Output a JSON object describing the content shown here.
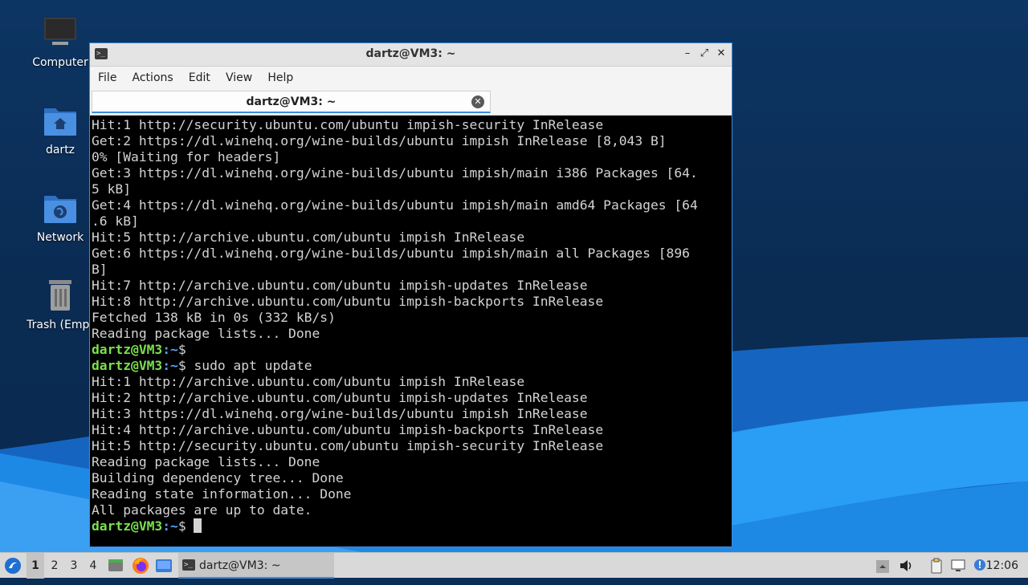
{
  "desktop": {
    "icons": [
      {
        "label": "Computer",
        "icon": "computer-icon"
      },
      {
        "label": "dartz",
        "icon": "home-folder-icon"
      },
      {
        "label": "Network",
        "icon": "network-folder-icon"
      },
      {
        "label": "Trash (Empt",
        "icon": "trash-icon"
      }
    ]
  },
  "window": {
    "title": "dartz@VM3: ~",
    "menu": [
      "File",
      "Actions",
      "Edit",
      "View",
      "Help"
    ],
    "tab_label": "dartz@VM3: ~",
    "accent": "#3a8be0"
  },
  "terminal": {
    "prompt_user": "dartz@VM3",
    "prompt_path": ":~",
    "prompt_symbol": "$",
    "lines": [
      {
        "text": "Hit:1 http://security.ubuntu.com/ubuntu impish-security InRelease"
      },
      {
        "text": "Get:2 https://dl.winehq.org/wine-builds/ubuntu impish InRelease [8,043 B]"
      },
      {
        "text": "0% [Waiting for headers]"
      },
      {
        "text": "Get:3 https://dl.winehq.org/wine-builds/ubuntu impish/main i386 Packages [64."
      },
      {
        "text": "5 kB]"
      },
      {
        "text": "Get:4 https://dl.winehq.org/wine-builds/ubuntu impish/main amd64 Packages [64"
      },
      {
        "text": ".6 kB]"
      },
      {
        "text": "Hit:5 http://archive.ubuntu.com/ubuntu impish InRelease"
      },
      {
        "text": "Get:6 https://dl.winehq.org/wine-builds/ubuntu impish/main all Packages [896"
      },
      {
        "text": "B]"
      },
      {
        "text": "Hit:7 http://archive.ubuntu.com/ubuntu impish-updates InRelease"
      },
      {
        "text": "Hit:8 http://archive.ubuntu.com/ubuntu impish-backports InRelease"
      },
      {
        "text": "Fetched 138 kB in 0s (332 kB/s)"
      },
      {
        "text": "Reading package lists... Done"
      },
      {
        "prompt": true,
        "text": ""
      },
      {
        "prompt": true,
        "text": " sudo apt update"
      },
      {
        "text": "Hit:1 http://archive.ubuntu.com/ubuntu impish InRelease"
      },
      {
        "text": "Hit:2 http://archive.ubuntu.com/ubuntu impish-updates InRelease"
      },
      {
        "text": "Hit:3 https://dl.winehq.org/wine-builds/ubuntu impish InRelease"
      },
      {
        "text": "Hit:4 http://archive.ubuntu.com/ubuntu impish-backports InRelease"
      },
      {
        "text": "Hit:5 http://security.ubuntu.com/ubuntu impish-security InRelease"
      },
      {
        "text": "Reading package lists... Done"
      },
      {
        "text": "Building dependency tree... Done"
      },
      {
        "text": "Reading state information... Done"
      },
      {
        "text": "All packages are up to date."
      },
      {
        "prompt": true,
        "text": " ",
        "cursor": true
      }
    ]
  },
  "taskbar": {
    "workspaces": [
      "1",
      "2",
      "3",
      "4"
    ],
    "active_workspace": "1",
    "task_label": "dartz@VM3: ~",
    "clock": "12:06"
  }
}
